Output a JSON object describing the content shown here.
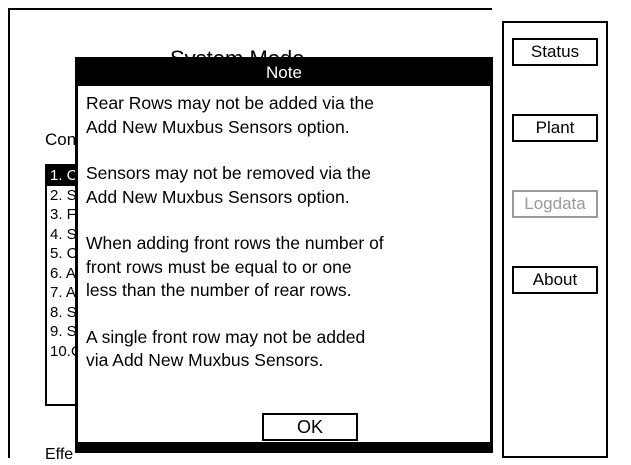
{
  "main": {
    "title": "System Mode",
    "config_label": "Con",
    "effect_label": "Effe",
    "menu_items": [
      "1. C",
      "2. S",
      "3. F",
      "4. S",
      "5. C",
      "6. A",
      "7. A",
      "8. S",
      "9. S",
      "10.C"
    ]
  },
  "side_buttons": {
    "status": "Status",
    "plant": "Plant",
    "logdata": "Logdata",
    "about": "About"
  },
  "dialog": {
    "title": "Note",
    "paragraphs": [
      [
        "Rear Rows may not be added via the",
        "Add New Muxbus Sensors option."
      ],
      [
        "Sensors may not be removed via the",
        "Add New Muxbus Sensors option."
      ],
      [
        "When adding front rows the number of",
        "front rows must be equal to or one",
        "less than the number of rear rows."
      ],
      [
        "A single front row may not be added",
        "via Add New Muxbus Sensors."
      ]
    ],
    "ok_label": "OK"
  }
}
